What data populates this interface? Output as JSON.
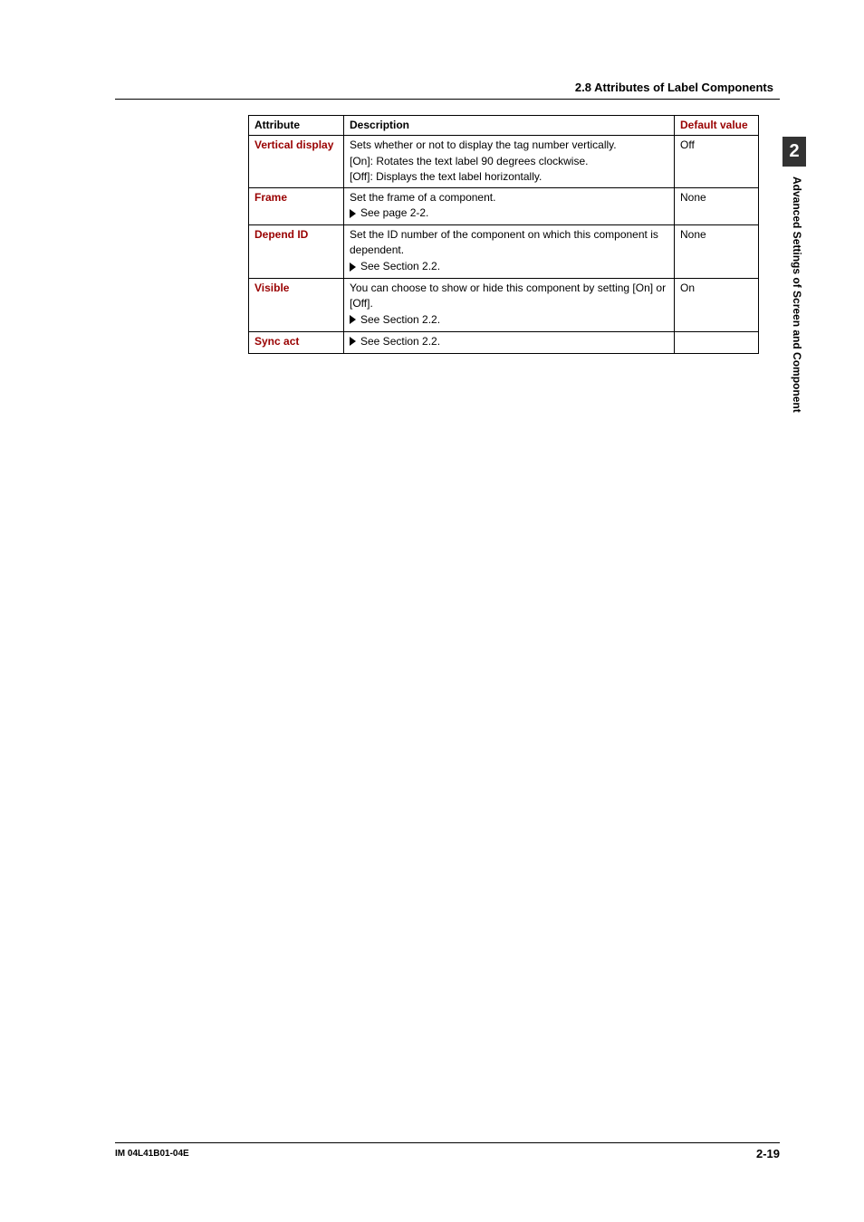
{
  "section_heading": "2.8  Attributes of Label Components",
  "side_tab_number": "2",
  "side_tab_label": "Advanced Settings of Screen and Component",
  "footer_left": "IM 04L41B01-04E",
  "footer_right": "2-19",
  "table": {
    "headers": {
      "attribute": "Attribute",
      "description": "Description",
      "default": "Default value"
    },
    "rows": [
      {
        "attribute": "Vertical display",
        "desc_lines": [
          "Sets whether or not to display the tag number vertically.",
          "[On]: Rotates the text label 90 degrees clockwise.",
          "[Off]: Displays the text label horizontally."
        ],
        "see_ref": "",
        "default": "Off"
      },
      {
        "attribute": "Frame",
        "desc_lines": [
          "Set the frame of a component."
        ],
        "see_ref": "See page 2-2.",
        "default": "None"
      },
      {
        "attribute": "Depend ID",
        "desc_lines": [
          "Set the ID number of the component on which this component is dependent."
        ],
        "see_ref": "See Section 2.2.",
        "default": "None"
      },
      {
        "attribute": "Visible",
        "desc_lines": [
          "You can choose to show or hide this component by setting [On] or [Off]."
        ],
        "see_ref": "See Section 2.2.",
        "default": "On"
      },
      {
        "attribute": "Sync act",
        "desc_lines": [],
        "see_ref": "See Section 2.2.",
        "default": ""
      }
    ]
  }
}
